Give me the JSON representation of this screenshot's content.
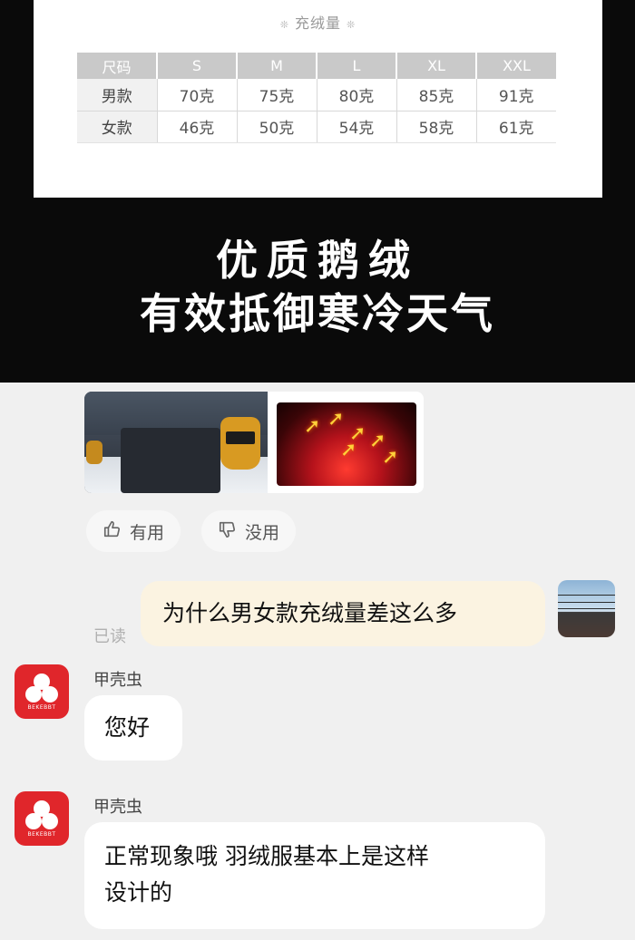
{
  "promo": {
    "sheet_title": "充绒量",
    "title_deco": "❊",
    "table": {
      "headers": [
        "尺码",
        "S",
        "M",
        "L",
        "XL",
        "XXL"
      ],
      "rows": [
        [
          "男款",
          "70克",
          "75克",
          "80克",
          "85克",
          "91克"
        ],
        [
          "女款",
          "46克",
          "50克",
          "54克",
          "58克",
          "61克"
        ]
      ]
    },
    "line1": "优质鹅绒",
    "line2": "有效抵御寒冷天气"
  },
  "review": {
    "heat_arrow": "➚",
    "useful_label": "有用",
    "useless_label": "没用"
  },
  "chat": {
    "my_message": "为什么男女款充绒量差这么多",
    "read_status": "已读",
    "shop_name": "甲壳虫",
    "shop_brand": "BEKEBBT",
    "reply1": "您好",
    "reply2_line1": "正常现象哦 羽绒服基本上是这样",
    "reply2_line2": "设计的"
  },
  "colors": {
    "shop_avatar": "#e0262b",
    "my_bubble": "#fbf3e1",
    "promo_bg": "#0a0a0a"
  },
  "icons": {
    "useful": "thumbs-up-icon",
    "useless": "thumbs-down-icon"
  }
}
